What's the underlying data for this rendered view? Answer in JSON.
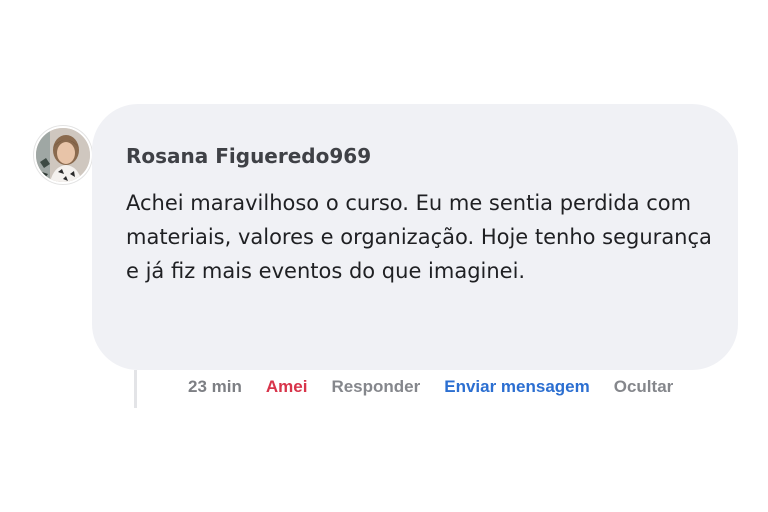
{
  "comment": {
    "author": "Rosana Figueredo969",
    "text": "Achei maravilhoso o curso. Eu me sentia perdida com materiais, valores e organização. Hoje tenho segurança e já fiz mais eventos do que imaginei.",
    "avatar_icon": "profile-photo"
  },
  "actions": {
    "time": "23 min",
    "like_label": "Amei",
    "reply_label": "Responder",
    "message_label": "Enviar mensagem",
    "hide_label": "Ocultar"
  },
  "colors": {
    "bubble": "#f0f1f5",
    "like": "#d8344a",
    "message": "#2c6fd1",
    "muted": "#85878c"
  }
}
